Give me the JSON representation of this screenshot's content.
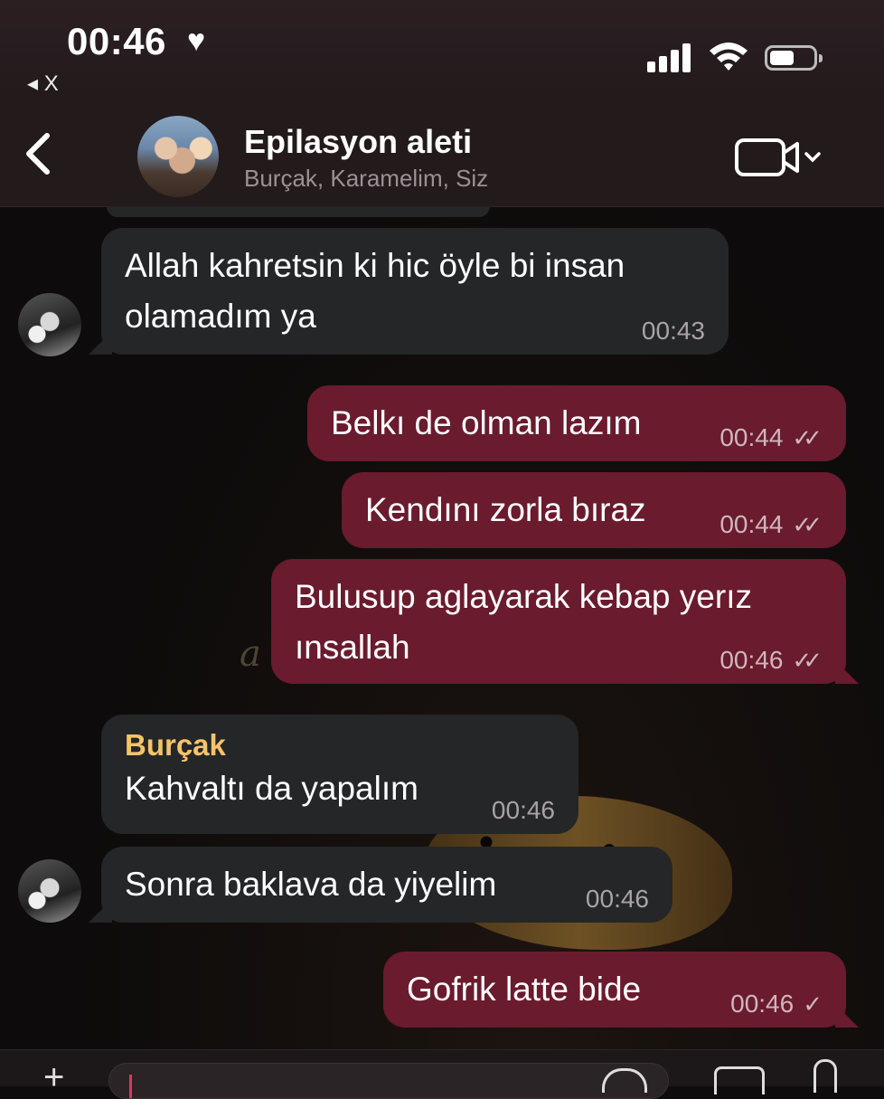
{
  "status_bar": {
    "time": "00:46",
    "heart": "♥",
    "back_app": "◂ X"
  },
  "header": {
    "title": "Epilasyon aleti",
    "participants": "Burçak, Karamelim, Siz",
    "video_icon": "video-camera-icon"
  },
  "messages": [
    {
      "direction": "in",
      "text_lines": [
        "Allah kahretsin ki hic öyle bi insan",
        "olamadım ya"
      ],
      "time": "00:43"
    },
    {
      "direction": "out",
      "text_lines": [
        "Belkı de olman lazım"
      ],
      "time": "00:44",
      "status": "read"
    },
    {
      "direction": "out",
      "text_lines": [
        "Kendını zorla bıraz"
      ],
      "time": "00:44",
      "status": "read"
    },
    {
      "direction": "out",
      "text_lines": [
        "Bulusup aglayarak kebap yerız",
        "ınsallah"
      ],
      "time": "00:46",
      "status": "read"
    },
    {
      "direction": "in",
      "sender": "Burçak",
      "text_lines": [
        "Kahvaltı da yapalım"
      ],
      "time": "00:46"
    },
    {
      "direction": "in",
      "text_lines": [
        "Sonra baklava da yiyelim"
      ],
      "time": "00:46"
    },
    {
      "direction": "out",
      "text_lines": [
        "Gofrik latte bide"
      ],
      "time": "00:46",
      "status": "sent"
    }
  ],
  "ticks": {
    "double": "✓✓",
    "single": "✓"
  },
  "input": {
    "attach": "+"
  },
  "colors": {
    "incoming_bubble": "#252627",
    "outgoing_bubble": "#6a1b2e",
    "sender_name": "#f5c36a",
    "header_bg": "#231a1c"
  }
}
